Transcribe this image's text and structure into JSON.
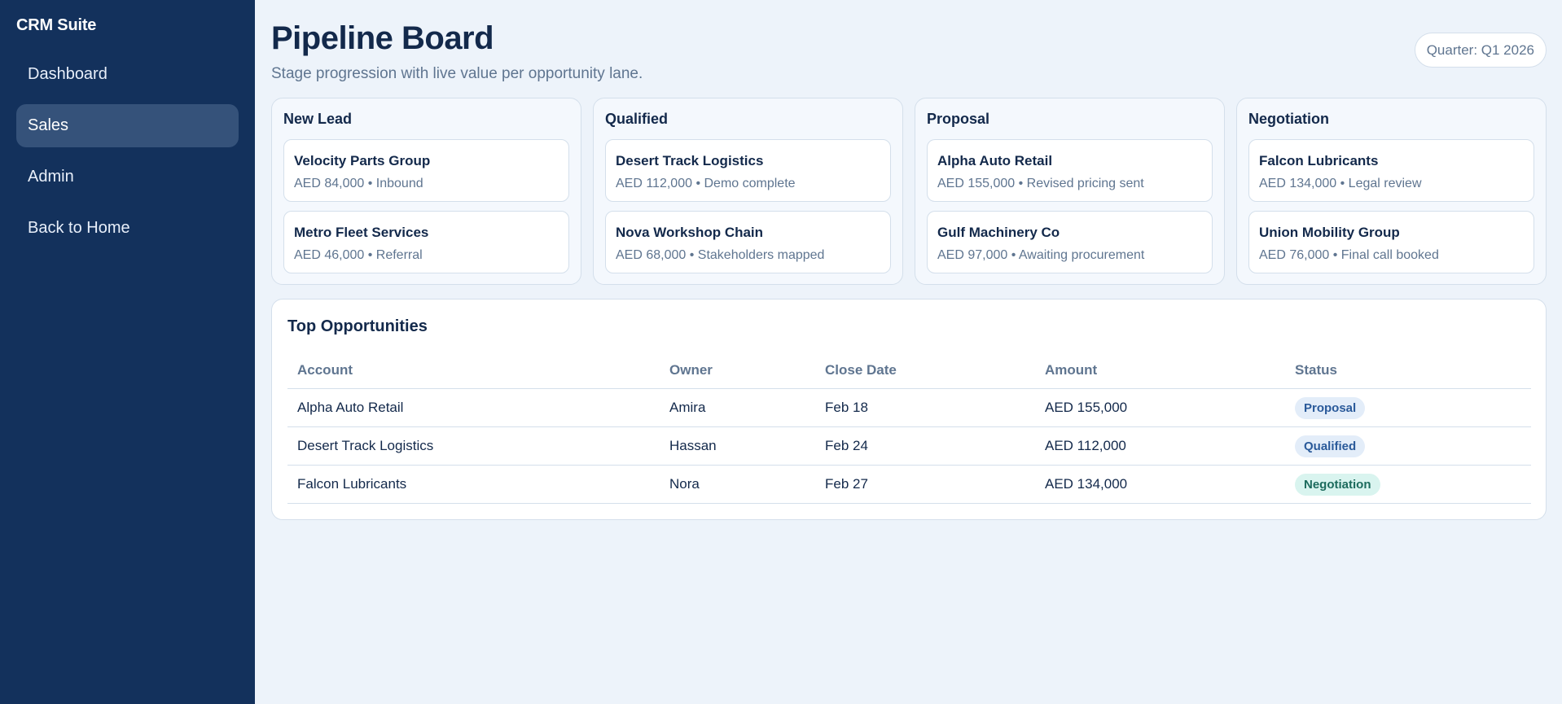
{
  "sidebar": {
    "brand": "CRM Suite",
    "items": [
      {
        "label": "Dashboard",
        "active": false
      },
      {
        "label": "Sales",
        "active": true
      },
      {
        "label": "Admin",
        "active": false
      },
      {
        "label": "Back to Home",
        "active": false
      }
    ]
  },
  "header": {
    "title": "Pipeline Board",
    "subtitle": "Stage progression with live value per opportunity lane.",
    "quarter": "Quarter: Q1 2026"
  },
  "lanes": [
    {
      "title": "New Lead",
      "cards": [
        {
          "name": "Velocity Parts Group",
          "meta": "AED 84,000 • Inbound"
        },
        {
          "name": "Metro Fleet Services",
          "meta": "AED 46,000 • Referral"
        }
      ]
    },
    {
      "title": "Qualified",
      "cards": [
        {
          "name": "Desert Track Logistics",
          "meta": "AED 112,000 • Demo complete"
        },
        {
          "name": "Nova Workshop Chain",
          "meta": "AED 68,000 • Stakeholders mapped"
        }
      ]
    },
    {
      "title": "Proposal",
      "cards": [
        {
          "name": "Alpha Auto Retail",
          "meta": "AED 155,000 • Revised pricing sent"
        },
        {
          "name": "Gulf Machinery Co",
          "meta": "AED 97,000 • Awaiting procurement"
        }
      ]
    },
    {
      "title": "Negotiation",
      "cards": [
        {
          "name": "Falcon Lubricants",
          "meta": "AED 134,000 • Legal review"
        },
        {
          "name": "Union Mobility Group",
          "meta": "AED 76,000 • Final call booked"
        }
      ]
    }
  ],
  "opportunities": {
    "title": "Top Opportunities",
    "columns": [
      "Account",
      "Owner",
      "Close Date",
      "Amount",
      "Status"
    ],
    "rows": [
      {
        "account": "Alpha Auto Retail",
        "owner": "Amira",
        "close_date": "Feb 18",
        "amount": "AED 155,000",
        "status": "Proposal"
      },
      {
        "account": "Desert Track Logistics",
        "owner": "Hassan",
        "close_date": "Feb 24",
        "amount": "AED 112,000",
        "status": "Qualified"
      },
      {
        "account": "Falcon Lubricants",
        "owner": "Nora",
        "close_date": "Feb 27",
        "amount": "AED 134,000",
        "status": "Negotiation"
      }
    ]
  },
  "status_colors": {
    "Proposal": {
      "bg": "#e3edf9",
      "fg": "#2a5a9a"
    },
    "Qualified": {
      "bg": "#e3edf9",
      "fg": "#2a5a9a"
    },
    "Negotiation": {
      "bg": "#d9f4ef",
      "fg": "#1c6b5d"
    }
  },
  "colors": {
    "sidebar_bg": "#13315c",
    "sidebar_active": "#35527a",
    "page_bg": "#edf3fa",
    "text_primary": "#13294b",
    "text_muted": "#5f7590"
  }
}
